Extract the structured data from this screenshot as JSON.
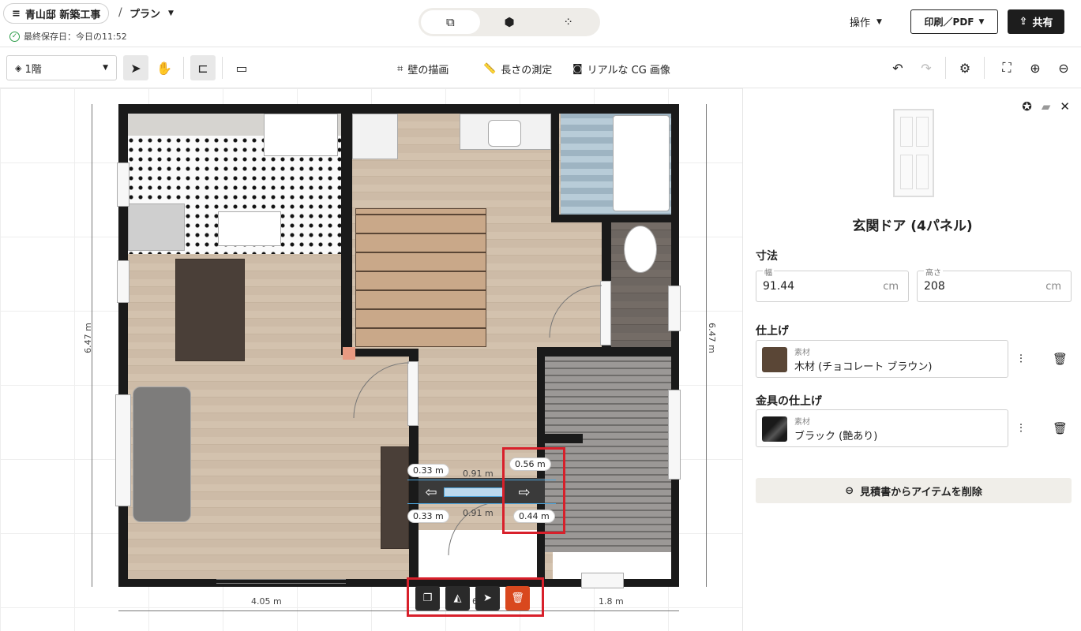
{
  "header": {
    "project_title": "青山邸 新築工事",
    "separator": "/",
    "plan_label": "プラン",
    "saved_text": "最終保存日：今日の11:52",
    "operations_label": "操作",
    "print_label": "印刷／PDF",
    "share_label": "共有"
  },
  "view_modes": [
    {
      "icon": "floorplan-2d-icon",
      "glyph": "⧉",
      "active": true
    },
    {
      "icon": "cube-3d-icon",
      "glyph": "⬢",
      "active": false
    },
    {
      "icon": "footprints-icon",
      "glyph": "👣",
      "active": false
    }
  ],
  "toolbar": {
    "floor_selector": "1階",
    "draw_walls": "壁の描画",
    "measure": "長さの測定",
    "render": "リアルな CG 画像"
  },
  "plan": {
    "dim_width_left": "4.05 m",
    "dim_width_mid": "6",
    "dim_width_right": "1.8 m",
    "dim_height_left": "6.47 m",
    "dim_height_right": "6.47 m",
    "m_033_top": "0.33 m",
    "m_091_top": "0.91 m",
    "m_056": "0.56 m",
    "m_033_bottom": "0.33 m",
    "m_091_bottom": "0.91 m",
    "m_044": "0.44 m"
  },
  "panel": {
    "item_title": "玄関ドア (4パネル)",
    "dimensions_label": "寸法",
    "width_label": "幅",
    "width_value": "91.44",
    "width_unit": "cm",
    "height_label": "高さ",
    "height_value": "208",
    "height_unit": "cm",
    "finish_label": "仕上げ",
    "finish_material_label": "素材",
    "finish_material_value": "木材 (チョコレート ブラウン)",
    "finish_color": "#5a4636",
    "hardware_label": "金具の仕上げ",
    "hardware_material_label": "素材",
    "hardware_material_value": "ブラック (艶あり)",
    "hardware_color": "#1a1a1a",
    "remove_label": "見積書からアイテムを削除"
  },
  "colors": {
    "highlight": "#d8202b",
    "delete": "#d9481e",
    "accent_dark": "#1d1d1d"
  }
}
